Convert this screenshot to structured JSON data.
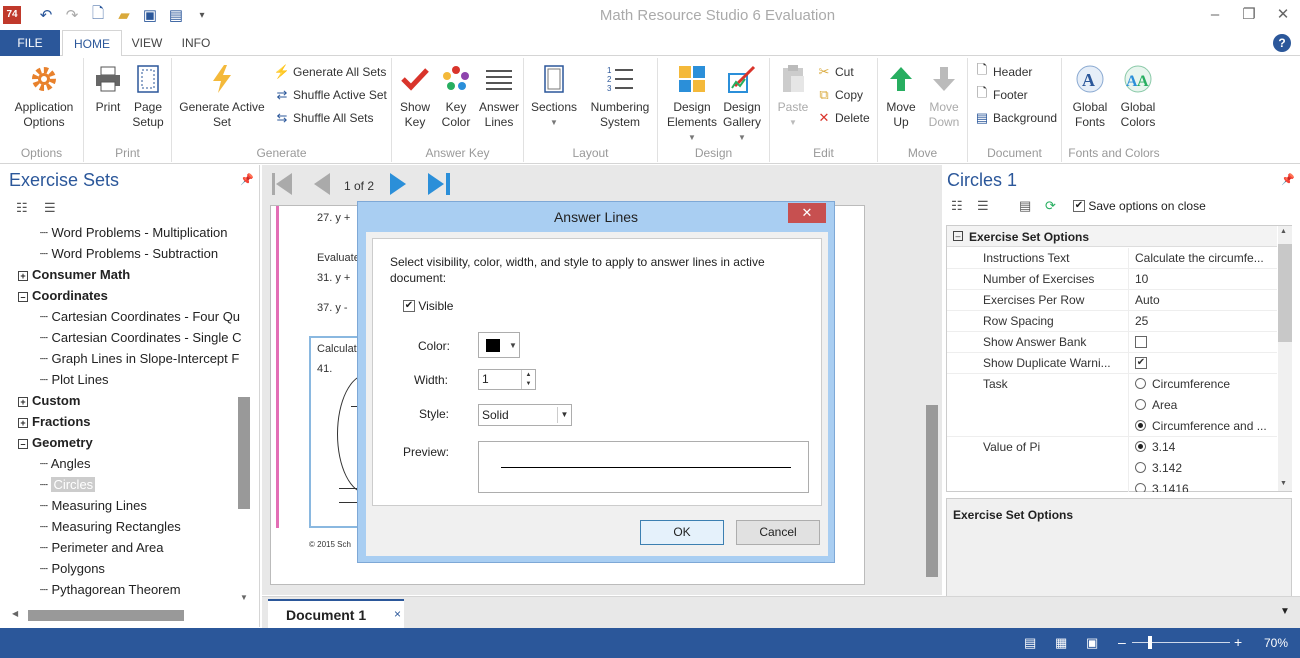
{
  "app": {
    "title": "Math Resource Studio 6 Evaluation",
    "logo_text": "74",
    "accent": "#2b579a"
  },
  "quick_access": [
    "undo-icon",
    "redo-icon",
    "new-icon",
    "open-icon",
    "save-icon",
    "save-as-icon",
    "customize-icon"
  ],
  "window_controls": {
    "minimize": "–",
    "restore": "❐",
    "close": "✕"
  },
  "tabs": {
    "file": "FILE",
    "home": "HOME",
    "view": "VIEW",
    "info": "INFO"
  },
  "ribbon": {
    "options": {
      "label": "Options",
      "app_options": "Application Options"
    },
    "print": {
      "label": "Print",
      "print": "Print",
      "page_setup": "Page Setup"
    },
    "generate": {
      "label": "Generate",
      "generate_active": "Generate Active Set",
      "generate_all": "Generate All Sets",
      "shuffle_active": "Shuffle Active Set",
      "shuffle_all": "Shuffle All Sets"
    },
    "answer_key": {
      "label": "Answer Key",
      "show_key": "Show Key",
      "key_color": "Key Color",
      "answer_lines": "Answer Lines"
    },
    "layout": {
      "label": "Layout",
      "sections": "Sections",
      "numbering": "Numbering System"
    },
    "design": {
      "label": "Design",
      "design_elements": "Design Elements",
      "design_gallery": "Design Gallery"
    },
    "edit": {
      "label": "Edit",
      "paste": "Paste",
      "cut": "Cut",
      "copy": "Copy",
      "delete": "Delete"
    },
    "move": {
      "label": "Move",
      "move_up": "Move Up",
      "move_down": "Move Down"
    },
    "document": {
      "label": "Document",
      "header": "Header",
      "footer": "Footer",
      "background": "Background"
    },
    "fonts_colors": {
      "label": "Fonts and Colors",
      "global_fonts": "Global Fonts",
      "global_colors": "Global Colors"
    }
  },
  "left_pane": {
    "title": "Exercise Sets",
    "items": [
      {
        "label": "Word Problems - Multiplication",
        "type": "leaf"
      },
      {
        "label": "Word Problems - Subtraction",
        "type": "leaf"
      },
      {
        "label": "Consumer Math",
        "type": "cat"
      },
      {
        "label": "Coordinates",
        "type": "cat"
      },
      {
        "label": "Cartesian Coordinates - Four Qu",
        "type": "leaf"
      },
      {
        "label": "Cartesian Coordinates - Single C",
        "type": "leaf"
      },
      {
        "label": "Graph Lines in Slope-Intercept F",
        "type": "leaf"
      },
      {
        "label": "Plot Lines",
        "type": "leaf"
      },
      {
        "label": "Custom",
        "type": "cat"
      },
      {
        "label": "Fractions",
        "type": "cat"
      },
      {
        "label": "Geometry",
        "type": "cat"
      },
      {
        "label": "Angles",
        "type": "leaf"
      },
      {
        "label": "Circles",
        "type": "leaf",
        "selected": true
      },
      {
        "label": "Measuring Lines",
        "type": "leaf"
      },
      {
        "label": "Measuring Rectangles",
        "type": "leaf"
      },
      {
        "label": "Perimeter and Area",
        "type": "leaf"
      },
      {
        "label": "Polygons",
        "type": "leaf"
      },
      {
        "label": "Pythagorean Theorem",
        "type": "leaf"
      }
    ]
  },
  "doc_nav": {
    "page_indicator": "1 of 2"
  },
  "doc_preview": {
    "row1": "27.   y +",
    "heading1": "Evaluate",
    "row2": "31.   y +",
    "row3": "37.   y -",
    "heading2": "Calculat",
    "row4": "41.",
    "copyright": "© 2015 Sch"
  },
  "dialog": {
    "title": "Answer Lines",
    "instruction": "Select visibility, color, width, and style to apply to answer lines in active document:",
    "visible_label": "Visible",
    "color_label": "Color:",
    "width_label": "Width:",
    "width_value": "1",
    "style_label": "Style:",
    "style_value": "Solid",
    "preview_label": "Preview:",
    "ok": "OK",
    "cancel": "Cancel"
  },
  "right_pane": {
    "title": "Circles 1",
    "save_on_close": "Save options on close",
    "section": "Exercise Set Options",
    "rows": {
      "instructions": {
        "k": "Instructions Text",
        "v": "Calculate the circumfe..."
      },
      "num_exercises": {
        "k": "Number of Exercises",
        "v": "10"
      },
      "per_row": {
        "k": "Exercises Per Row",
        "v": "Auto"
      },
      "spacing": {
        "k": "Row Spacing",
        "v": "25"
      },
      "answer_bank": {
        "k": "Show Answer Bank"
      },
      "duplicate": {
        "k": "Show Duplicate Warni..."
      },
      "task": {
        "k": "Task",
        "o1": "Circumference",
        "o2": "Area",
        "o3": "Circumference and ..."
      },
      "pi": {
        "k": "Value of Pi",
        "o1": "3.14",
        "o2": "3.142",
        "o3": "3.1416"
      }
    },
    "desc_title": "Exercise Set Options"
  },
  "doc_tab": {
    "label": "Document 1",
    "close": "×"
  },
  "status": {
    "zoom": "70%",
    "minus": "–",
    "plus": "+"
  }
}
